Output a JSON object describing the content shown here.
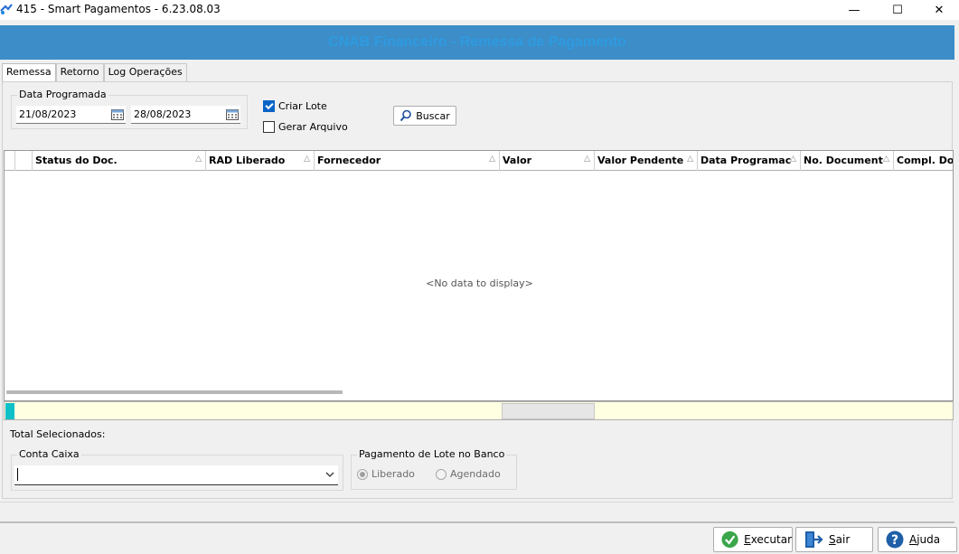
{
  "window": {
    "title": "415 - Smart Pagamentos - 6.23.08.03",
    "minimize": "—",
    "maximize": "☐",
    "close": "✕"
  },
  "banner": {
    "title": "CNAB Financeiro - Remessa de Pagamento"
  },
  "tabs": [
    {
      "label": "Remessa",
      "active": true
    },
    {
      "label": "Retorno",
      "active": false
    },
    {
      "label": "Log Operações",
      "active": false
    }
  ],
  "filters": {
    "data_programada_label": "Data Programada",
    "date_from": "21/08/2023",
    "date_to": "28/08/2023",
    "criar_lote_label": "Criar Lote",
    "criar_lote_checked": true,
    "gerar_arquivo_label": "Gerar Arquivo",
    "gerar_arquivo_checked": false,
    "buscar_label": "Buscar"
  },
  "grid": {
    "columns": [
      "Status do Doc.",
      "RAD Liberado",
      "Fornecedor",
      "Valor",
      "Valor Pendente",
      "Data Programac",
      "No. Document",
      "Compl. Doc"
    ],
    "sort_glyph": "△",
    "empty_text": "<No data to display>"
  },
  "bottom": {
    "total_label": "Total Selecionados:",
    "conta_caixa_label": "Conta Caixa",
    "conta_caixa_value": "",
    "pagamento_label": "Pagamento de Lote no Banco",
    "liberado_label": "Liberado",
    "agendado_label": "Agendado",
    "selected": "Liberado"
  },
  "actions": {
    "executar_first": "E",
    "executar_rest": "xecutar",
    "sair_first": "S",
    "sair_rest": "air",
    "ajuda_first": "A",
    "ajuda_rest": "juda"
  },
  "colors": {
    "banner_bg": "#3c8dc8",
    "banner_text": "#2e9be0",
    "footer_band": "#ffffe1",
    "indicator": "#10c0c8"
  }
}
